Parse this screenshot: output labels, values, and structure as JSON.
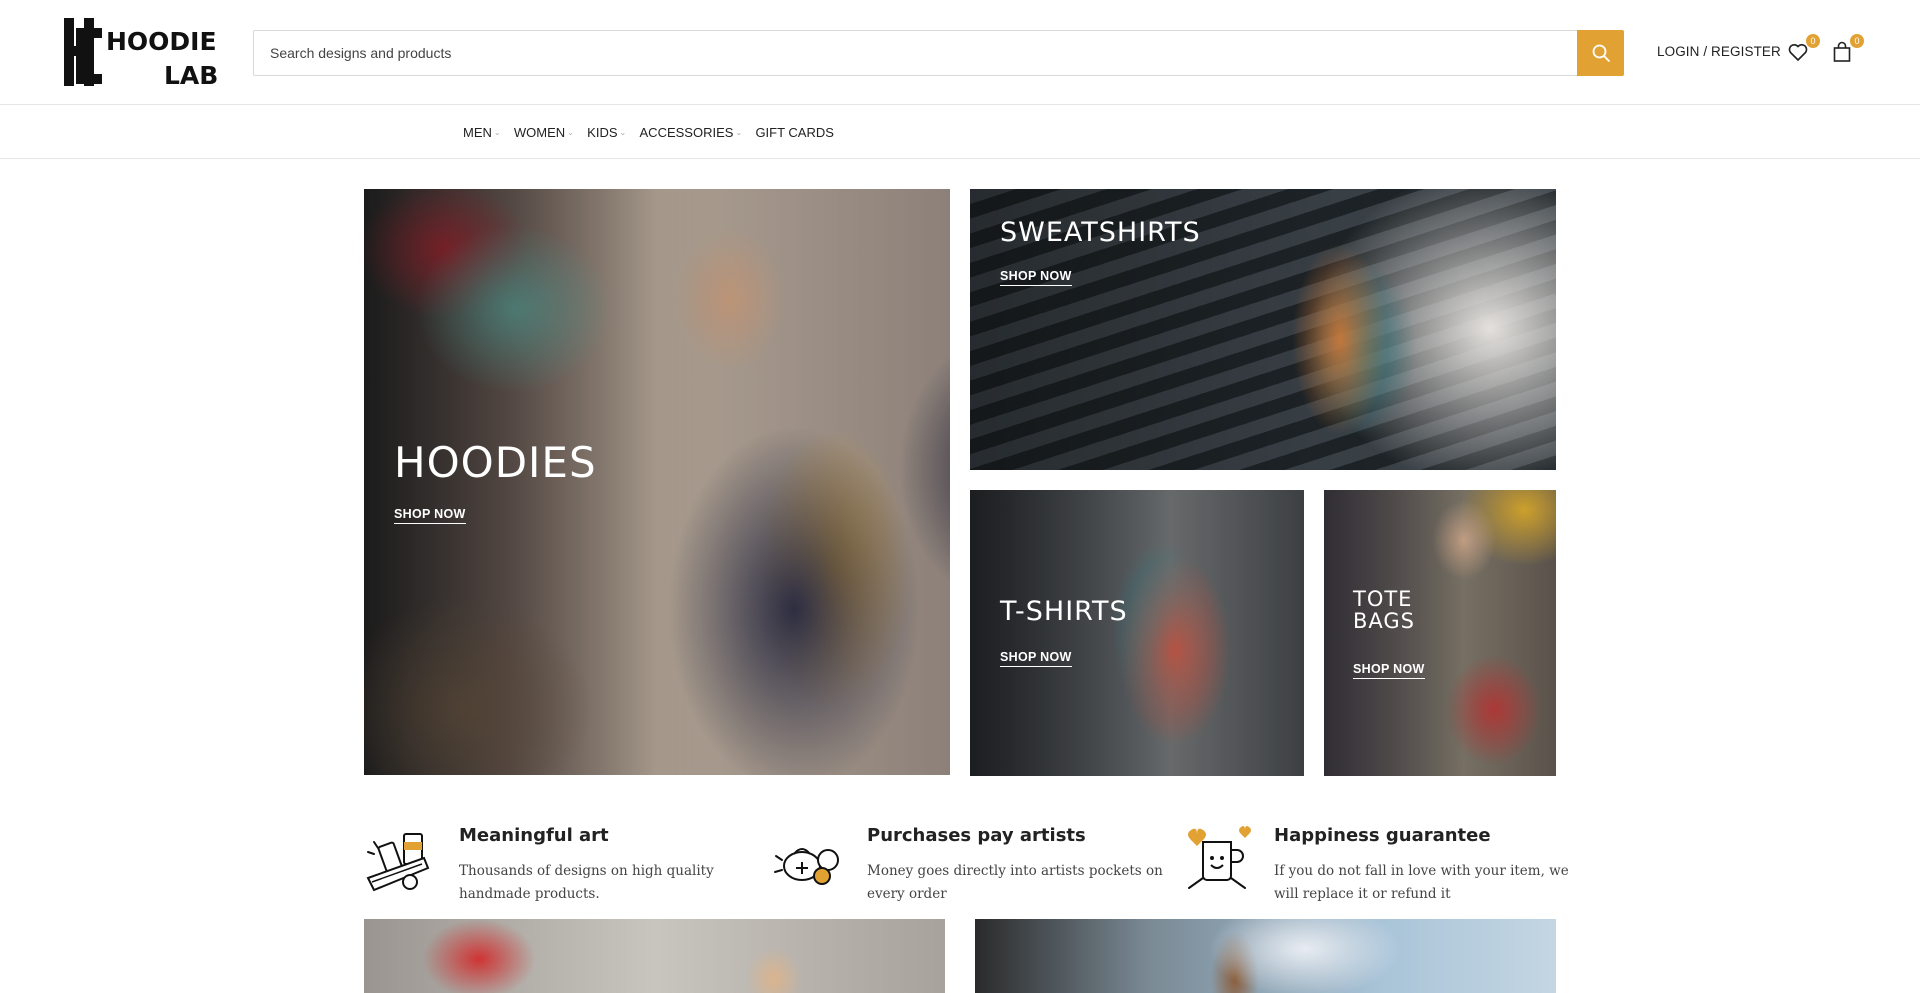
{
  "brand": {
    "logo_text_line1": "HOODIE",
    "logo_text_line2": "LAB",
    "accent_color": "#e1a233"
  },
  "search": {
    "placeholder": "Search designs and products"
  },
  "header": {
    "login_label": "LOGIN / REGISTER",
    "wishlist_count": "0",
    "cart_count": "0"
  },
  "nav": {
    "items": [
      {
        "label": "MEN",
        "dropdown": true
      },
      {
        "label": "WOMEN",
        "dropdown": true
      },
      {
        "label": "KIDS",
        "dropdown": true
      },
      {
        "label": "ACCESSORIES",
        "dropdown": true
      },
      {
        "label": "GIFT CARDS",
        "dropdown": false
      }
    ]
  },
  "banners": {
    "hoodies": {
      "title": "HOODIES",
      "cta": "SHOP NOW"
    },
    "sweatshirts": {
      "title": "SWEATSHIRTS",
      "cta": "SHOP NOW"
    },
    "tshirts": {
      "title": "T-SHIRTS",
      "cta": "SHOP NOW"
    },
    "totebags": {
      "title_line1": "TOTE",
      "title_line2": "BAGS",
      "cta": "SHOP NOW"
    }
  },
  "features": [
    {
      "title": "Meaningful art",
      "text": "Thousands of designs on high quality handmade products.",
      "icon": "paint-cans-icon"
    },
    {
      "title": "Purchases pay artists",
      "text": "Money goes directly into artists pockets on every order",
      "icon": "money-bag-icon"
    },
    {
      "title": "Happiness guarantee",
      "text": "If you do not fall in love with your item, we will replace it or refund it",
      "icon": "happy-mug-icon"
    }
  ]
}
